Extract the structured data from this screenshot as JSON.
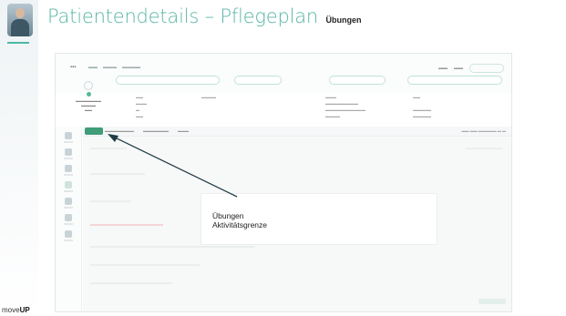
{
  "slide": {
    "title": "Patientendetails – Pflegeplan",
    "subtitle": "Übungen",
    "callout_line1": "Übungen",
    "callout_line2": "Aktivitätsgrenze",
    "brand_light": "move",
    "brand_bold": "UP"
  },
  "colors": {
    "accent": "#59b6a4",
    "active_tab": "#3f9d79"
  }
}
